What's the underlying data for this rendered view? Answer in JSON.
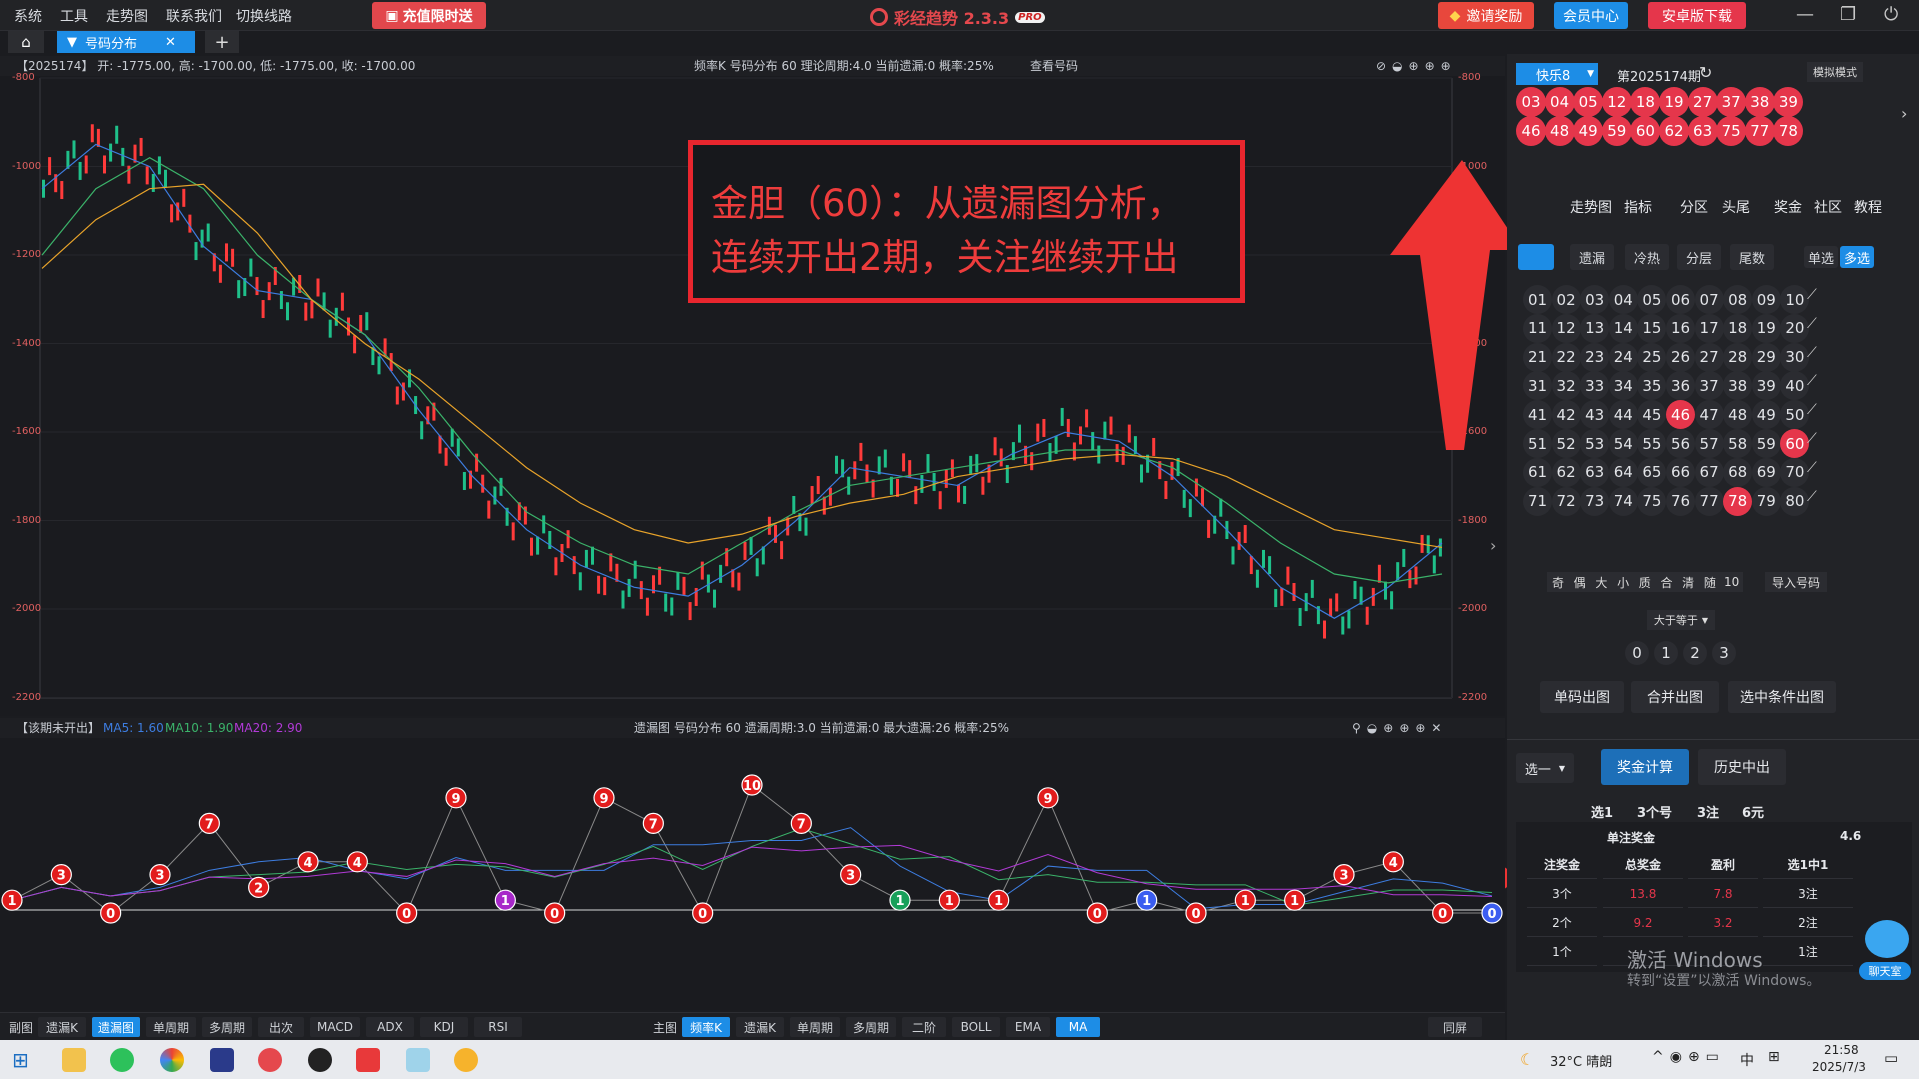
{
  "menu": [
    "系统",
    "工具",
    "走势图",
    "联系我们",
    "切换线路"
  ],
  "promo": "充值限时送",
  "app_title": "彩经趋势 2.3.3",
  "app_badge": "PRO",
  "top_buttons": {
    "invite": "邀请奖励",
    "member": "会员中心",
    "android": "安卓版下载"
  },
  "tab": {
    "label": "号码分布"
  },
  "main_header": {
    "ohlc": "【2025174】 开: -1775.00, 高: -1700.00, 低: -1775.00, 收: -1700.00",
    "info": "频率K  号码分布  60   理论周期:4.0   当前遗漏:0   概率:25%",
    "link": "查看号码"
  },
  "y_axis": [
    "-800",
    "-1000",
    "-1200",
    "-1400",
    "-1600",
    "-1800",
    "-2000",
    "-2200"
  ],
  "lower_header": {
    "left": "【该期未开出】",
    "ma5": "MA5: 1.60",
    "ma10": "MA10: 1.90",
    "ma20": "MA20: 2.90",
    "info": "遗漏图  号码分布  60   遗漏周期:3.0   当前遗漏:0   最大遗漏:26   概率:25%"
  },
  "annotation": {
    "line1": "金胆（60）：从遗漏图分析，",
    "line2": "连续开出2期，关注继续开出"
  },
  "bottom_left": [
    "副图",
    "遗漏K",
    "遗漏图",
    "单周期",
    "多周期",
    "出次",
    "MACD",
    "ADX",
    "KDJ",
    "RSI"
  ],
  "bottom_right": [
    "主图",
    "频率K",
    "遗漏K",
    "单周期",
    "多周期",
    "二阶",
    "BOLL",
    "EMA",
    "MA"
  ],
  "bottom_sync": "同屏",
  "colors": {
    "accent": "#1d8de6",
    "red": "#e5364b",
    "ma5": "#3d7de0",
    "ma10": "#3bb36a",
    "ma20": "#e8a32a"
  },
  "chart_data": {
    "type": "line",
    "title": "",
    "ylim": [
      -2200,
      -800
    ],
    "series": [
      {
        "name": "MA5",
        "values": [
          -1050,
          -950,
          -1000,
          -1180,
          -1280,
          -1300,
          -1380,
          -1550,
          -1700,
          -1820,
          -1900,
          -1950,
          -1970,
          -1900,
          -1800,
          -1680,
          -1700,
          -1720,
          -1650,
          -1600,
          -1620,
          -1700,
          -1820,
          -1950,
          -2020,
          -1950,
          -1850
        ]
      },
      {
        "name": "MA10",
        "values": [
          -1200,
          -1050,
          -980,
          -1050,
          -1200,
          -1300,
          -1380,
          -1500,
          -1650,
          -1780,
          -1850,
          -1900,
          -1920,
          -1850,
          -1780,
          -1720,
          -1700,
          -1680,
          -1660,
          -1640,
          -1640,
          -1680,
          -1760,
          -1850,
          -1920,
          -1940,
          -1920
        ]
      },
      {
        "name": "MA20",
        "values": [
          -1230,
          -1120,
          -1050,
          -1040,
          -1150,
          -1300,
          -1400,
          -1480,
          -1580,
          -1680,
          -1760,
          -1820,
          -1850,
          -1830,
          -1790,
          -1760,
          -1740,
          -1700,
          -1680,
          -1660,
          -1650,
          -1660,
          -1700,
          -1760,
          -1820,
          -1840,
          -1860
        ]
      }
    ],
    "omission_values": [
      1,
      3,
      0,
      3,
      7,
      2,
      4,
      4,
      0,
      9,
      1,
      0,
      9,
      7,
      0,
      10,
      7,
      3,
      1,
      1,
      1,
      9,
      0,
      1,
      0,
      1,
      1,
      3,
      4,
      0,
      0
    ]
  },
  "right": {
    "lottery": "快乐8",
    "period": "第2025174期",
    "sim": "模拟模式",
    "draw": [
      "03",
      "04",
      "05",
      "12",
      "18",
      "19",
      "27",
      "37",
      "38",
      "39",
      "46",
      "48",
      "49",
      "59",
      "60",
      "62",
      "63",
      "75",
      "77",
      "78"
    ],
    "nav": [
      "走势图",
      "指标",
      "分区",
      "头尾",
      "奖金",
      "社区",
      "教程"
    ],
    "subtabs": [
      "遗漏",
      "冷热",
      "分层",
      "尾数"
    ],
    "single": "单选",
    "multi": "多选",
    "grid_selected": [
      "46",
      "60",
      "78"
    ],
    "filters": [
      "奇",
      "偶",
      "大",
      "小",
      "质",
      "合",
      "清",
      "随",
      "10"
    ],
    "import": "导入号码",
    "cmp": "大于等于",
    "counts": [
      "0",
      "1",
      "2",
      "3"
    ],
    "actions": [
      "单码出图",
      "合并出图",
      "选中条件出图"
    ],
    "select": "选一",
    "calc": "奖金计算",
    "history": "历史中出",
    "summary": [
      "选1",
      "3个号",
      "3注",
      "6元"
    ],
    "single_prize_label": "单注奖金",
    "single_prize": "4.6",
    "table_head": [
      "注奖金",
      "总奖金",
      "盈利",
      "选1中1"
    ],
    "rows": [
      [
        "3个",
        "13.8",
        "7.8",
        "3注"
      ],
      [
        "2个",
        "9.2",
        "3.2",
        "2注"
      ],
      [
        "1个",
        "",
        "",
        "1注"
      ]
    ],
    "activate1": "激活 Windows",
    "activate2": "转到“设置”以激活 Windows。",
    "chat": "聊天室"
  },
  "taskbar": {
    "weather": "32°C 晴朗",
    "ime": "中",
    "time": "21:58",
    "date": "2025/7/3"
  }
}
